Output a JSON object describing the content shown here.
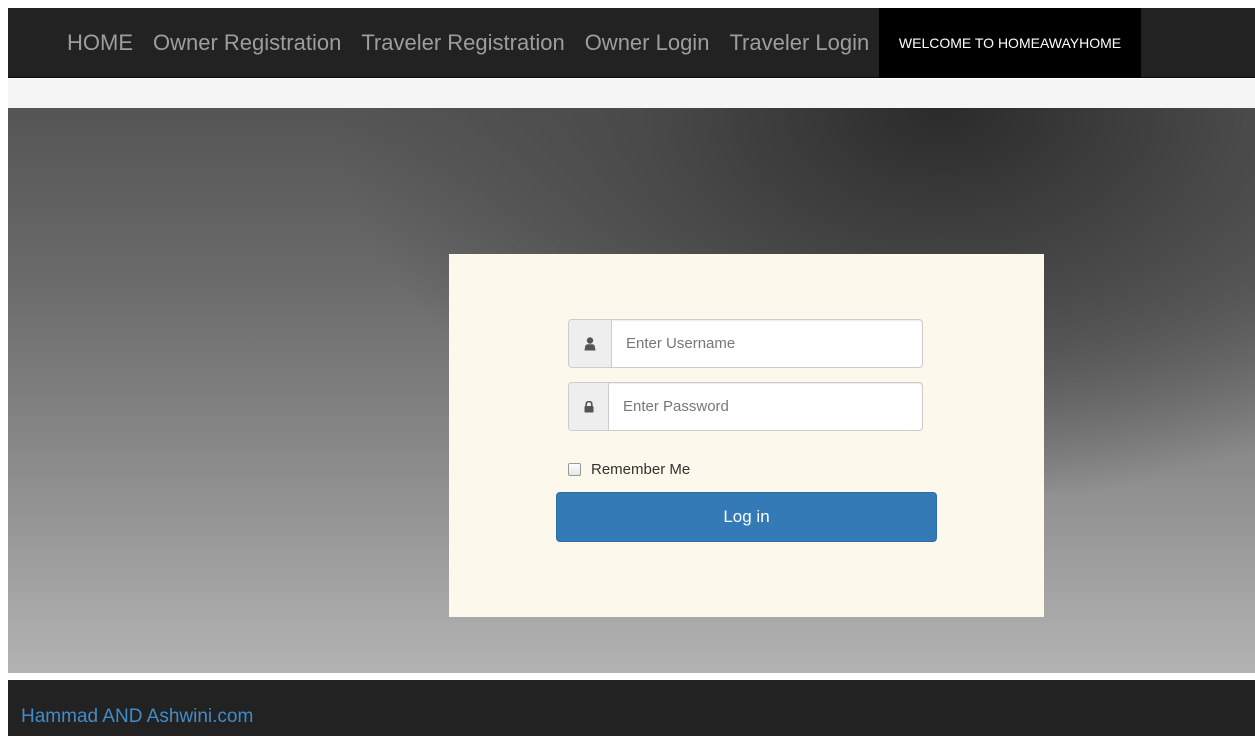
{
  "nav": {
    "links": [
      {
        "label": "HOME"
      },
      {
        "label": "Owner Registration"
      },
      {
        "label": "Traveler Registration"
      },
      {
        "label": "Owner Login"
      },
      {
        "label": "Traveler Login"
      }
    ],
    "welcome": "WELCOME TO HOMEAWAYHOME"
  },
  "login": {
    "username_placeholder": "Enter Username",
    "password_placeholder": "Enter Password",
    "remember_label": "Remember Me",
    "remember_checked": false,
    "submit_label": "Log in",
    "icons": {
      "username": "user-icon",
      "password": "lock-icon"
    }
  },
  "footer": {
    "text": "Hammad AND Ashwini.com"
  },
  "colors": {
    "navbar_bg": "#222222",
    "welcome_bg": "#000000",
    "panel_bg": "#fdf8ec",
    "button_bg": "#337ab7",
    "footer_link": "#428bca"
  }
}
